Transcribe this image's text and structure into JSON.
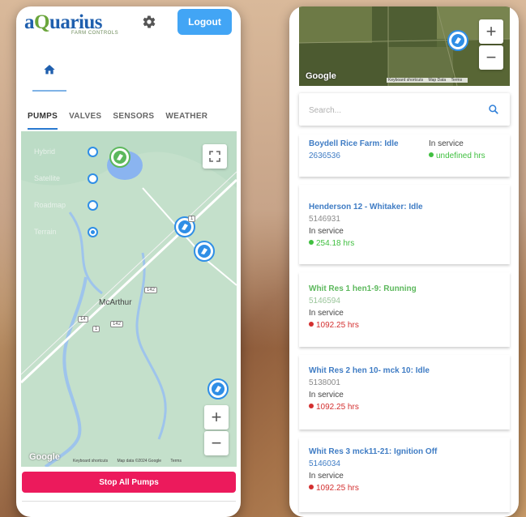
{
  "header": {
    "logo_text_1": "a",
    "logo_text_2": "Q",
    "logo_text_3": "uarius",
    "logo_subtitle": "FARM CONTROLS",
    "logout_label": "Logout"
  },
  "tabs": [
    {
      "label": "PUMPS",
      "active": true
    },
    {
      "label": "VALVES",
      "active": false
    },
    {
      "label": "SENSORS",
      "active": false
    },
    {
      "label": "WEATHER",
      "active": false
    }
  ],
  "map_left": {
    "layers": [
      {
        "label": "Hybrid",
        "checked": false
      },
      {
        "label": "Satellite",
        "checked": false
      },
      {
        "label": "Roadmap",
        "checked": false
      },
      {
        "label": "Terrain",
        "checked": true
      }
    ],
    "town": "McArthur",
    "road_tags": [
      "1",
      "142",
      "1",
      "142",
      "14"
    ],
    "zoom_in": "+",
    "zoom_out": "−",
    "google_label": "Google",
    "attribution": [
      "Keyboard shortcuts",
      "Map data ©2024 Google",
      "Terms"
    ]
  },
  "stop_all_label": "Stop All Pumps",
  "map_right": {
    "zoom_in": "+",
    "zoom_out": "−",
    "google_label": "Google",
    "attribution": [
      "Keyboard shortcuts",
      "Map Data",
      "Terms"
    ]
  },
  "search": {
    "placeholder": "Search..."
  },
  "pumps": [
    {
      "title": "Boydell Rice Farm: Idle",
      "serial": "2636536",
      "status": "In service",
      "hours": "undefined hrs",
      "state": "idle",
      "hours_color": "#3fbf3f"
    },
    {
      "title": "Henderson 12 - Whitaker: Idle",
      "serial": "5146931",
      "status": "In service",
      "hours": "254.18 hrs",
      "state": "idle",
      "hours_color": "#3fbf3f"
    },
    {
      "title": "Whit Res 1 hen1-9: Running",
      "serial": "5146594",
      "status": "In service",
      "hours": "1092.25 hrs",
      "state": "running",
      "hours_color": "#d32f2f"
    },
    {
      "title": "Whit Res 2 hen 10- mck 10: Idle",
      "serial": "5138001",
      "status": "In service",
      "hours": "1092.25 hrs",
      "state": "idle",
      "hours_color": "#d32f2f"
    },
    {
      "title": "Whit Res 3 mck11-21: Ignition Off",
      "serial": "5146034",
      "status": "In service",
      "hours": "1092.25 hrs",
      "state": "idle",
      "hours_color": "#d32f2f"
    }
  ],
  "colors": {
    "brand_blue": "#1f5fae",
    "logout": "#42a5f5",
    "stop": "#ec1a5c",
    "idle_title": "#3f7cc4",
    "running_title": "#5cb85c"
  }
}
